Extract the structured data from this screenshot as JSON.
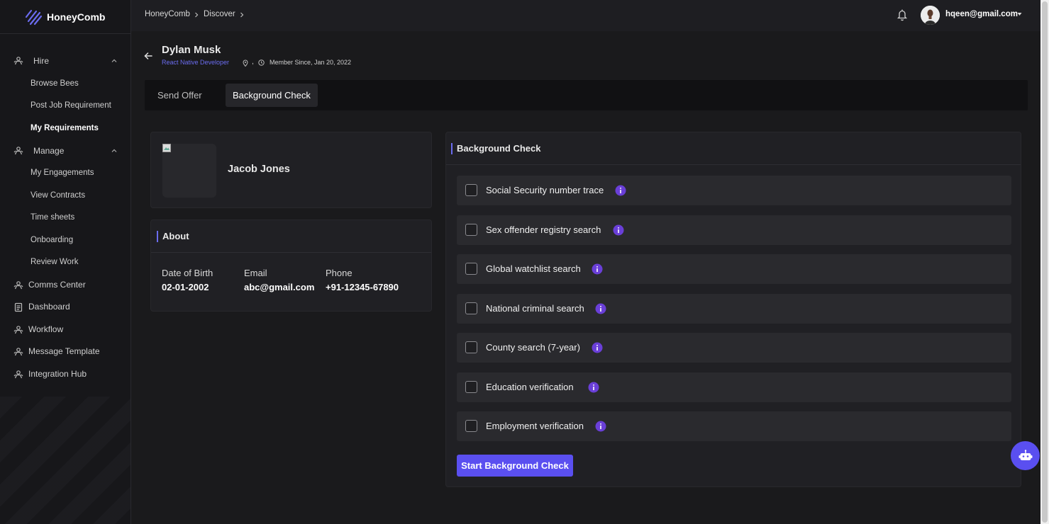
{
  "app": {
    "name": "HoneyComb"
  },
  "colors": {
    "accent": "#5a4ff0",
    "link": "#6b6cf0",
    "background": "#1a1a1c",
    "sidebar": "#17171a",
    "card": "#202024"
  },
  "sidebar": {
    "hire": {
      "label": "Hire",
      "icon": "people-icon",
      "items": [
        "Browse Bees",
        "Post Job Requirement",
        "My Requirements"
      ]
    },
    "manage": {
      "label": "Manage",
      "icon": "people-icon",
      "items": [
        "My Engagements",
        "View Contracts",
        "Time sheets",
        "Onboarding",
        "Review Work"
      ]
    },
    "items": [
      "Comms Center",
      "Dashboard",
      "Workflow",
      "Message Template",
      "Integration Hub"
    ]
  },
  "breadcrumb": [
    "HoneyComb",
    "Discover"
  ],
  "user": {
    "email": "hqeen@gmail.com"
  },
  "profile": {
    "name": "Dylan Musk",
    "role": "React Native Developer",
    "separator": ",",
    "member_since": "Member Since, Jan 20, 2022"
  },
  "tabs": {
    "send_offer": "Send Offer",
    "background_check": "Background Check",
    "active": "background_check"
  },
  "candidate": {
    "name": "Jacob Jones"
  },
  "about": {
    "title": "About",
    "fields": [
      {
        "label": "Date of Birth",
        "value": "02-01-2002"
      },
      {
        "label": "Email",
        "value": "abc@gmail.com"
      },
      {
        "label": "Phone",
        "value": "+91-12345-67890"
      }
    ]
  },
  "background_check": {
    "title": "Background Check",
    "checks": [
      {
        "label": "Social Security number trace",
        "checked": false
      },
      {
        "label": "Sex offender registry search",
        "checked": false
      },
      {
        "label": "Global watchlist search",
        "checked": false
      },
      {
        "label": "National criminal search",
        "checked": false
      },
      {
        "label": "County search (7-year)",
        "checked": false
      },
      {
        "label": "Education verification",
        "checked": false
      },
      {
        "label": "Employment verification",
        "checked": false
      }
    ],
    "start_button": "Start Background Check"
  }
}
